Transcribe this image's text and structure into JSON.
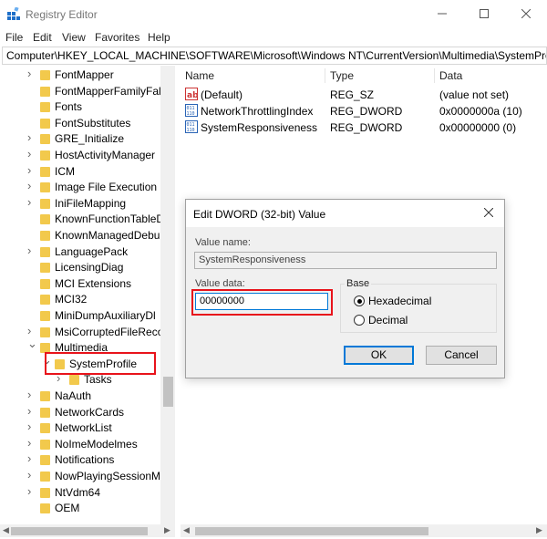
{
  "window": {
    "title": "Registry Editor"
  },
  "menu": [
    "File",
    "Edit",
    "View",
    "Favorites",
    "Help"
  ],
  "address": "Computer\\HKEY_LOCAL_MACHINE\\SOFTWARE\\Microsoft\\Windows NT\\CurrentVersion\\Multimedia\\SystemProfile",
  "tree": [
    {
      "label": "FontMapper",
      "state": "collapsed"
    },
    {
      "label": "FontMapperFamilyFall",
      "state": "none"
    },
    {
      "label": "Fonts",
      "state": "none"
    },
    {
      "label": "FontSubstitutes",
      "state": "none"
    },
    {
      "label": "GRE_Initialize",
      "state": "collapsed"
    },
    {
      "label": "HostActivityManager",
      "state": "collapsed"
    },
    {
      "label": "ICM",
      "state": "collapsed"
    },
    {
      "label": "Image File Execution (",
      "state": "collapsed"
    },
    {
      "label": "IniFileMapping",
      "state": "collapsed"
    },
    {
      "label": "KnownFunctionTableD",
      "state": "none"
    },
    {
      "label": "KnownManagedDebu",
      "state": "none"
    },
    {
      "label": "LanguagePack",
      "state": "collapsed"
    },
    {
      "label": "LicensingDiag",
      "state": "none"
    },
    {
      "label": "MCI Extensions",
      "state": "none"
    },
    {
      "label": "MCI32",
      "state": "none"
    },
    {
      "label": "MiniDumpAuxiliaryDl",
      "state": "none"
    },
    {
      "label": "MsiCorruptedFileReco",
      "state": "collapsed"
    },
    {
      "label": "Multimedia",
      "state": "expanded"
    },
    {
      "label": "SystemProfile",
      "state": "expanded",
      "level": 1,
      "selected": true
    },
    {
      "label": "Tasks",
      "state": "collapsed",
      "level": 2
    },
    {
      "label": "NaAuth",
      "state": "collapsed"
    },
    {
      "label": "NetworkCards",
      "state": "collapsed"
    },
    {
      "label": "NetworkList",
      "state": "collapsed"
    },
    {
      "label": "NoImeModelmes",
      "state": "collapsed"
    },
    {
      "label": "Notifications",
      "state": "collapsed"
    },
    {
      "label": "NowPlayingSessionM",
      "state": "collapsed"
    },
    {
      "label": "NtVdm64",
      "state": "collapsed"
    },
    {
      "label": "OEM",
      "state": "none"
    }
  ],
  "list": {
    "columns": [
      "Name",
      "Type",
      "Data"
    ],
    "rows": [
      {
        "name": "(Default)",
        "type": "REG_SZ",
        "data": "(value not set)",
        "icon": "string-value-icon"
      },
      {
        "name": "NetworkThrottlingIndex",
        "type": "REG_DWORD",
        "data": "0x0000000a (10)",
        "icon": "binary-value-icon"
      },
      {
        "name": "SystemResponsiveness",
        "type": "REG_DWORD",
        "data": "0x00000000 (0)",
        "icon": "binary-value-icon"
      }
    ]
  },
  "dialog": {
    "title": "Edit DWORD (32-bit) Value",
    "value_name_label": "Value name:",
    "value_name": "SystemResponsiveness",
    "value_data_label": "Value data:",
    "value_data": "00000000",
    "base_label": "Base",
    "hex_label": "Hexadecimal",
    "dec_label": "Decimal",
    "selected_base": "Hexadecimal",
    "ok_label": "OK",
    "cancel_label": "Cancel"
  },
  "colors": {
    "highlight": "#e8131b",
    "folder": "#f2c94c",
    "accent": "#0078d7"
  }
}
